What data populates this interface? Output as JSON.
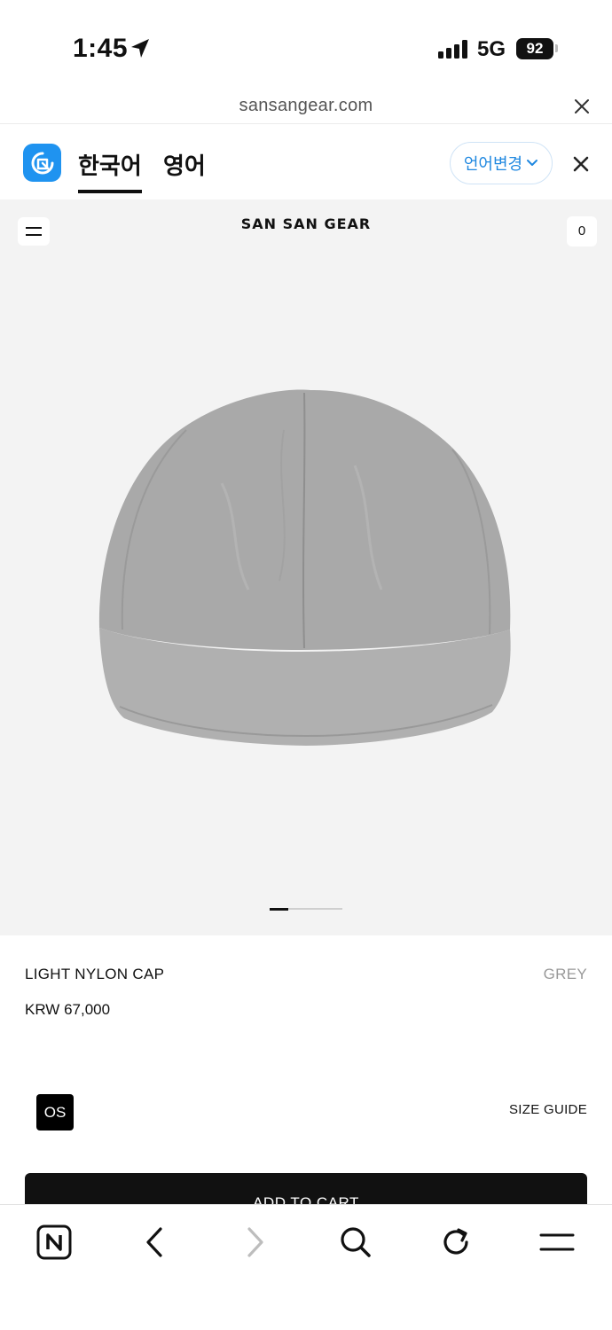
{
  "status_bar": {
    "time": "1:45",
    "network": "5G",
    "battery": "92"
  },
  "browser": {
    "url": "sansangear.com"
  },
  "translate": {
    "tabs": [
      {
        "label": "한국어",
        "active": true
      },
      {
        "label": "영어",
        "active": false
      }
    ],
    "change_language": "언어변경"
  },
  "site": {
    "logo": "SAN SAN GEAR",
    "cart_count": "0",
    "pager": {
      "total": 4,
      "current": 1
    }
  },
  "product": {
    "name": "LIGHT NYLON CAP",
    "color": "GREY",
    "price": "KRW 67,000",
    "size": "OS",
    "size_guide": "SIZE GUIDE",
    "add_to_cart": "ADD TO CART"
  },
  "toolbar": {
    "items": [
      "naver-icon",
      "back-icon",
      "forward-icon",
      "search-icon",
      "refresh-icon",
      "menu-icon"
    ]
  },
  "colors": {
    "accent_blue": "#1f93f0",
    "product_bg": "#f3f3f3",
    "cap_grey": "#a9a9a9"
  }
}
